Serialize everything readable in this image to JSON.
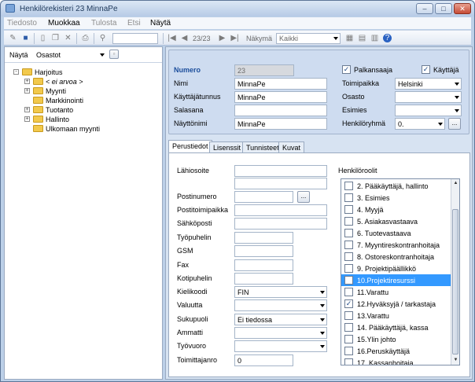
{
  "window": {
    "title": "Henkilörekisteri 23 MinnaPe",
    "min": "–",
    "max": "□",
    "close": "✕"
  },
  "menu": [
    "Tiedosto",
    "Muokkaa",
    "Tulosta",
    "Etsi",
    "Näytä"
  ],
  "menu_disabled": [
    true,
    false,
    true,
    true,
    false
  ],
  "toolbar": {
    "record_position": "23/23",
    "view_label": "Näkymä",
    "view_value": "Kaikki",
    "nav_first": "|◀",
    "nav_prev": "◀",
    "nav_next": "▶",
    "nav_last": "▶|"
  },
  "left": {
    "show_label": "Näytä",
    "show_value": "Osastot",
    "tree": [
      {
        "label": "Harjoitus",
        "expander": "-"
      },
      {
        "label": "< ei arvoa >",
        "expander": "+"
      },
      {
        "label": "Myynti",
        "expander": "+"
      },
      {
        "label": "Markkinointi",
        "expander": ""
      },
      {
        "label": "Tuotanto",
        "expander": "+"
      },
      {
        "label": "Hallinto",
        "expander": "+"
      },
      {
        "label": "Ulkomaan myynti",
        "expander": ""
      }
    ]
  },
  "header": {
    "numero_label": "Numero",
    "numero_value": "23",
    "nimi_label": "Nimi",
    "nimi_value": "MinnaPe",
    "kayttajatunnus_label": "Käyttäjätunnus",
    "kayttajatunnus_value": "MinnaPe",
    "salasana_label": "Salasana",
    "salasana_value": "",
    "nayttonimi_label": "Näyttönimi",
    "nayttonimi_value": "MinnaPe",
    "palkansaaja_label": "Palkansaaja",
    "palkansaaja_checked": true,
    "kayttaja_label": "Käyttäjä",
    "kayttaja_checked": true,
    "toimipaikka_label": "Toimipaikka",
    "toimipaikka_value": "Helsinki",
    "osasto_label": "Osasto",
    "osasto_value": "",
    "esimies_label": "Esimies",
    "esimies_value": "",
    "henkiloryhma_label": "Henkilöryhmä",
    "henkiloryhma_value": "0.",
    "browse_label": "..."
  },
  "tabs": [
    "Perustiedot",
    "Lisenssit",
    "Tunnisteet",
    "Kuvat"
  ],
  "basic": {
    "lahiosoite_label": "Lähiosoite",
    "lahiosoite_line1": "",
    "lahiosoite_line2": "",
    "postinumero_label": "Postinumero",
    "postinumero_value": "",
    "postitoimipaikka_label": "Postitoimipaikka",
    "postitoimipaikka_value": "",
    "sahkoposti_label": "Sähköposti",
    "sahkoposti_value": "",
    "tyopuhelin_label": "Työpuhelin",
    "tyopuhelin_value": "",
    "gsm_label": "GSM",
    "gsm_value": "",
    "fax_label": "Fax",
    "fax_value": "",
    "kotipuhelin_label": "Kotipuhelin",
    "kotipuhelin_value": "",
    "kielikoodi_label": "Kielikoodi",
    "kielikoodi_value": "FIN",
    "valuutta_label": "Valuutta",
    "valuutta_value": "",
    "sukupuoli_label": "Sukupuoli",
    "sukupuoli_value": "Ei tiedossa",
    "ammatti_label": "Ammatti",
    "ammatti_value": "",
    "tyovuoro_label": "Työvuoro",
    "tyovuoro_value": "",
    "toimittajanro_label": "Toimittajanro",
    "toimittajanro_value": "0",
    "browse_label": "..."
  },
  "roles": {
    "title": "Henkilöroolit",
    "items": [
      {
        "label": "2. Pääkäyttäjä, hallinto",
        "checked": false,
        "selected": false
      },
      {
        "label": "3. Esimies",
        "checked": false,
        "selected": false
      },
      {
        "label": "4. Myyjä",
        "checked": false,
        "selected": false
      },
      {
        "label": "5. Asiakasvastaava",
        "checked": false,
        "selected": false
      },
      {
        "label": "6. Tuotevastaava",
        "checked": false,
        "selected": false
      },
      {
        "label": "7. Myyntireskontranhoitaja",
        "checked": false,
        "selected": false
      },
      {
        "label": "8. Ostoreskontranhoitaja",
        "checked": false,
        "selected": false
      },
      {
        "label": "9. Projektipäällikkö",
        "checked": false,
        "selected": false
      },
      {
        "label": "10.Projektiresurssi",
        "checked": false,
        "selected": true
      },
      {
        "label": "11.Varattu",
        "checked": false,
        "selected": false
      },
      {
        "label": "12.Hyväksyjä / tarkastaja",
        "checked": true,
        "selected": false
      },
      {
        "label": "13.Varattu",
        "checked": false,
        "selected": false
      },
      {
        "label": "14. Pääkäyttäjä, kassa",
        "checked": false,
        "selected": false
      },
      {
        "label": "15.Ylin johto",
        "checked": false,
        "selected": false
      },
      {
        "label": "16.Peruskäyttäjä",
        "checked": false,
        "selected": false
      },
      {
        "label": "17. Kassanhoitaja",
        "checked": false,
        "selected": false
      }
    ]
  },
  "colors": {
    "selection": "#3399ff",
    "header_bg": "#cedcf0",
    "frame": "#bcd0e8"
  }
}
